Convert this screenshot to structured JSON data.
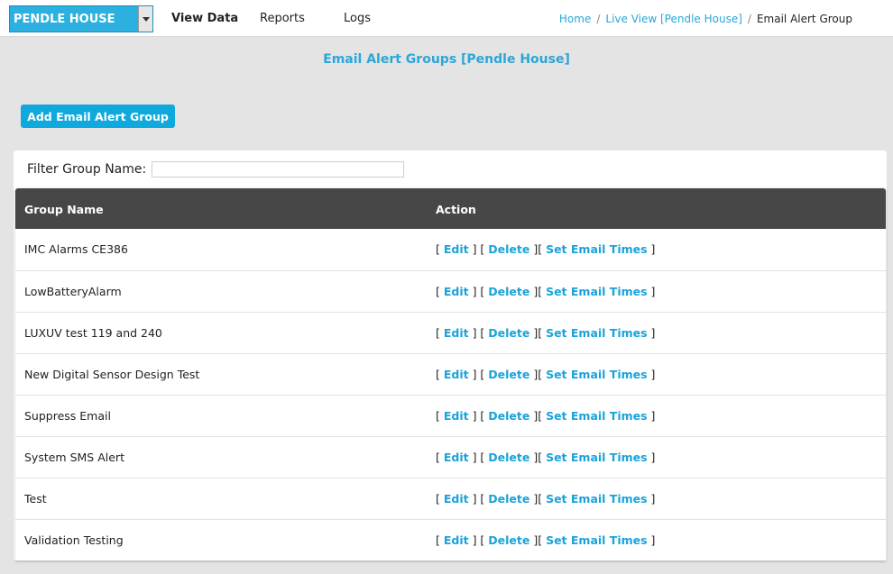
{
  "header": {
    "site_select": {
      "value": "PENDLE HOUSE"
    },
    "nav": [
      {
        "label": "View Data",
        "active": true
      },
      {
        "label": "Reports",
        "active": false
      },
      {
        "label": "Logs",
        "active": false
      }
    ],
    "breadcrumb": [
      {
        "label": "Home",
        "link": true
      },
      {
        "label": "Live View [Pendle House]",
        "link": true
      },
      {
        "label": "Email Alert Group",
        "link": false
      }
    ],
    "breadcrumb_separator": "/"
  },
  "page": {
    "title": "Email Alert Groups [Pendle House]",
    "add_button": "Add Email Alert Group"
  },
  "filter": {
    "label": "Filter Group Name:",
    "value": ""
  },
  "table": {
    "columns": [
      "Group Name",
      "Action"
    ],
    "action_labels": {
      "edit": "Edit",
      "delete": "Delete",
      "set_times": "Set Email Times"
    },
    "rows": [
      "IMC Alarms CE386",
      "LowBatteryAlarm",
      "LUXUV test 119 and 240",
      "New Digital Sensor Design Test",
      "Suppress Email",
      "System SMS Alert",
      "Test",
      "Validation Testing"
    ]
  },
  "colors": {
    "accent": "#2aa7d8",
    "button": "#0fa9dd",
    "table_header": "#474747",
    "page_bg": "#e4e4e4"
  }
}
